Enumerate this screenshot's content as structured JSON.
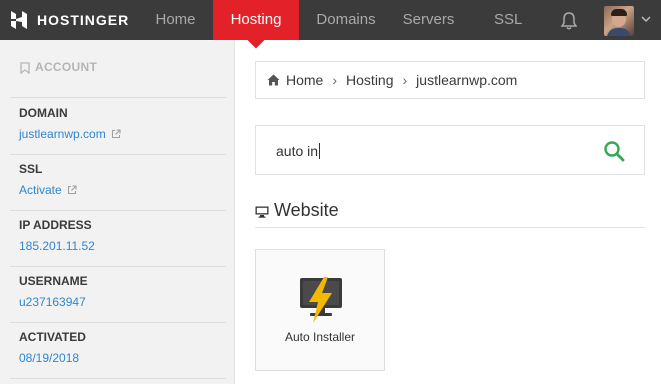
{
  "brand": {
    "name": "HOSTINGER"
  },
  "nav": {
    "items": [
      {
        "label": "Home"
      },
      {
        "label": "Hosting"
      },
      {
        "label": "Domains"
      },
      {
        "label": "Servers"
      },
      {
        "label": "SSL"
      }
    ],
    "active": "Hosting"
  },
  "sidebar": {
    "heading": "ACCOUNT",
    "fields": [
      {
        "label": "DOMAIN",
        "value": "justlearnwp.com",
        "external": true
      },
      {
        "label": "SSL",
        "value": "Activate",
        "external": true
      },
      {
        "label": "IP ADDRESS",
        "value": "185.201.11.52",
        "external": false
      },
      {
        "label": "USERNAME",
        "value": "u237163947",
        "external": false
      },
      {
        "label": "ACTIVATED",
        "value": "08/19/2018",
        "external": false
      }
    ]
  },
  "breadcrumb": [
    "Home",
    "Hosting",
    "justlearnwp.com"
  ],
  "search": {
    "value": "auto in"
  },
  "section": {
    "title": "Website"
  },
  "cards": [
    {
      "label": "Auto Installer",
      "icon": "auto-installer-icon"
    }
  ],
  "colors": {
    "accent": "#e32129",
    "link": "#2f86d0",
    "search_icon": "#36a852",
    "topbar": "#3b3b3b",
    "bolt": "#f5b800"
  },
  "icons": {
    "logo": "hostinger-logo-icon",
    "notifications": "bell-icon",
    "user_menu": "chevron-down-icon",
    "account": "bookmark-icon",
    "external": "external-link-icon",
    "home": "home-icon",
    "search": "search-icon",
    "section": "monitor-icon"
  }
}
